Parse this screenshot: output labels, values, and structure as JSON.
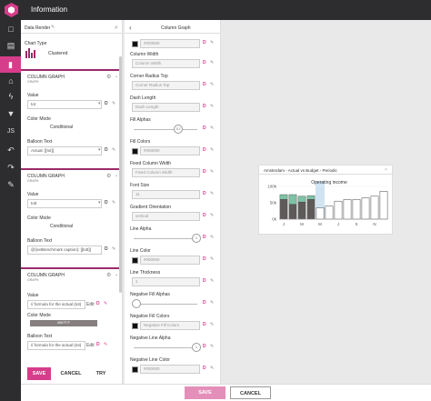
{
  "app": {
    "title": "Information"
  },
  "left": {
    "data_render": "Data Render",
    "chart_type_label": "Chart Type",
    "chart_type_value": "Clustered",
    "sections": [
      {
        "title": "COLUMN GRAPH",
        "subtitle": "GRAPH",
        "value_label": "Value",
        "value": "tot",
        "color_mode_label": "Color Mode",
        "color_mode": "Conditional",
        "balloon_label": "Balloon Text",
        "balloon": "Actual: [[tot]]"
      },
      {
        "title": "COLUMN GRAPH",
        "subtitle": "GRAPH",
        "value_label": "Value",
        "value": "tott",
        "color_mode_label": "Color Mode",
        "color_mode": "Conditional",
        "balloon_label": "Balloon Text",
        "balloon": "@{setBenchmark caption}: [[tott]]"
      },
      {
        "title": "COLUMN GRAPH",
        "subtitle": "GRAPH",
        "value_label": "Value",
        "value": "// formula for the actual (tot)",
        "edit": "Edit",
        "color_mode_label": "Color Mode",
        "color_mode": "#867F7F",
        "balloon_label": "Balloon Text",
        "balloon": "// formula for the actual (tot)"
      }
    ],
    "buttons": {
      "save": "SAVE",
      "cancel": "CANCEL",
      "try": "TRY"
    }
  },
  "middle": {
    "header": "Column Graph",
    "items": [
      {
        "label": "Column Width",
        "value": "Column Width",
        "type": "input"
      },
      {
        "label": "Corner Radius Top",
        "value": "Corner Radius Top",
        "type": "input"
      },
      {
        "label": "Dash Length",
        "value": "Dash Length",
        "type": "input"
      },
      {
        "label": "Fill Alphas",
        "value": "0.7",
        "type": "slider",
        "level": 0.7
      },
      {
        "label": "Fill Colors",
        "value": "#000000",
        "type": "color"
      },
      {
        "label": "Fixed Column Width",
        "value": "Fixed Column Width",
        "type": "input"
      },
      {
        "label": "Font Size",
        "value": "11",
        "type": "input"
      },
      {
        "label": "Gradient Orientation",
        "value": "vertical",
        "type": "select"
      },
      {
        "label": "Line Alpha",
        "value": "1",
        "type": "slider",
        "level": 1
      },
      {
        "label": "Line Color",
        "value": "#000000",
        "type": "color"
      },
      {
        "label": "Line Thickness",
        "value": "1",
        "type": "input"
      },
      {
        "label": "Negative Fill Alphas",
        "value": "",
        "type": "slider",
        "level": 0
      },
      {
        "label": "Negative Fill Colors",
        "value": "Negative Fill Colors",
        "type": "color"
      },
      {
        "label": "Negative Line Alpha",
        "value": "1",
        "type": "slider",
        "level": 1
      },
      {
        "label": "Negative Line Color",
        "value": "#000000",
        "type": "color"
      }
    ],
    "top_color": "#000000"
  },
  "preview": {
    "card_title": "Amsterdam - Actual vs Budget - Periodic",
    "chart_title": "Operating income"
  },
  "chart_data": {
    "type": "bar",
    "title": "Operating income",
    "categories": [
      "J",
      "",
      "M",
      "",
      "M",
      "",
      "J",
      "",
      "S",
      "",
      "N",
      ""
    ],
    "x_tick_labels": [
      "J",
      "M",
      "M",
      "J",
      "S",
      "N"
    ],
    "series": [
      {
        "values": [
          60,
          45,
          52,
          60,
          0,
          0,
          0,
          0,
          0,
          0,
          0,
          0
        ]
      },
      {
        "values": [
          75,
          75,
          70,
          72,
          35,
          40,
          55,
          60,
          60,
          65,
          70,
          85
        ]
      }
    ],
    "ylim": [
      0,
      100
    ],
    "y_ticks": [
      "100k",
      "50k",
      "0k"
    ],
    "highlight_index": 4
  },
  "bottom": {
    "save": "SAVE",
    "cancel": "CANCEL"
  }
}
